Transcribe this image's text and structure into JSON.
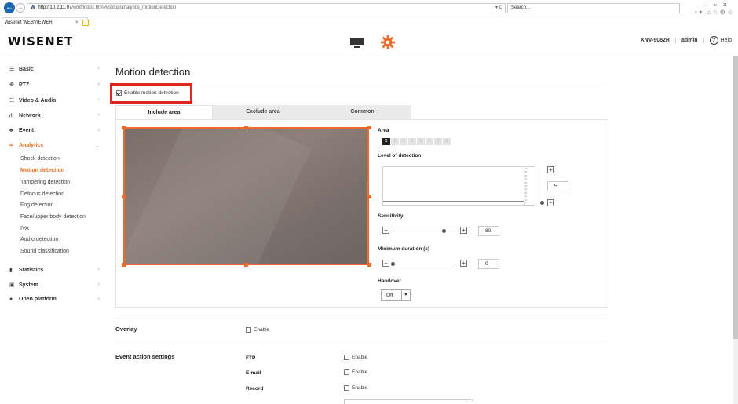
{
  "browser": {
    "url_host": "http://10.2.11.97",
    "url_path": "/wmf/index.html#/setup/analytics_motionDetection",
    "url_right": "▾ C",
    "search_placeholder": "Search...",
    "tab_title": "Wisenet WEBVIEWER",
    "tab_close": "×"
  },
  "header": {
    "logo": "WISENET",
    "model": "XNV-9082R",
    "user": "admin",
    "help": "Help"
  },
  "sidebar": {
    "menus": [
      {
        "icon": "☰",
        "label": "Basic"
      },
      {
        "icon": "✥",
        "label": "PTZ"
      },
      {
        "icon": "☷",
        "label": "Video & Audio"
      },
      {
        "icon": "⛙",
        "label": "Network"
      },
      {
        "icon": "♣",
        "label": "Event"
      },
      {
        "icon": "⌗",
        "label": "Analytics"
      },
      {
        "icon": "▮",
        "label": "Statistics"
      },
      {
        "icon": "▣",
        "label": "System"
      },
      {
        "icon": "●",
        "label": "Open platform"
      }
    ],
    "analytics_items": [
      "Shock detection",
      "Motion detection",
      "Tampering detection",
      "Defocus detection",
      "Fog detection",
      "Face/upper body detection",
      "IVA",
      "Audio detection",
      "Sound classification"
    ]
  },
  "main": {
    "title": "Motion detection",
    "enable_label": "Enable motion detection",
    "enable_checked": true,
    "tabs": [
      "Include area",
      "Exclude area",
      "Common"
    ],
    "area_label": "Area",
    "areas": [
      "1",
      "2",
      "3",
      "4",
      "5",
      "6",
      "7",
      "8"
    ],
    "level_label": "Level of detection",
    "level_value": "5",
    "level_ticks": [
      "100",
      "90",
      "80",
      "70",
      "60",
      "50",
      "40",
      "30",
      "20",
      "10",
      "0"
    ],
    "sensitivity_label": "Sensitivity",
    "sensitivity_value": "80",
    "min_duration_label": "Minimum duration (s)",
    "min_duration_value": "0",
    "handover_label": "Handover",
    "handover_value": "Off"
  },
  "overlay": {
    "title": "Overlay",
    "enable": "Enable"
  },
  "event_action": {
    "title": "Event action settings",
    "rows": [
      {
        "label": "FTP",
        "enable": "Enable"
      },
      {
        "label": "E-mail",
        "enable": "Enable"
      },
      {
        "label": "Record",
        "enable": "Enable"
      }
    ]
  }
}
